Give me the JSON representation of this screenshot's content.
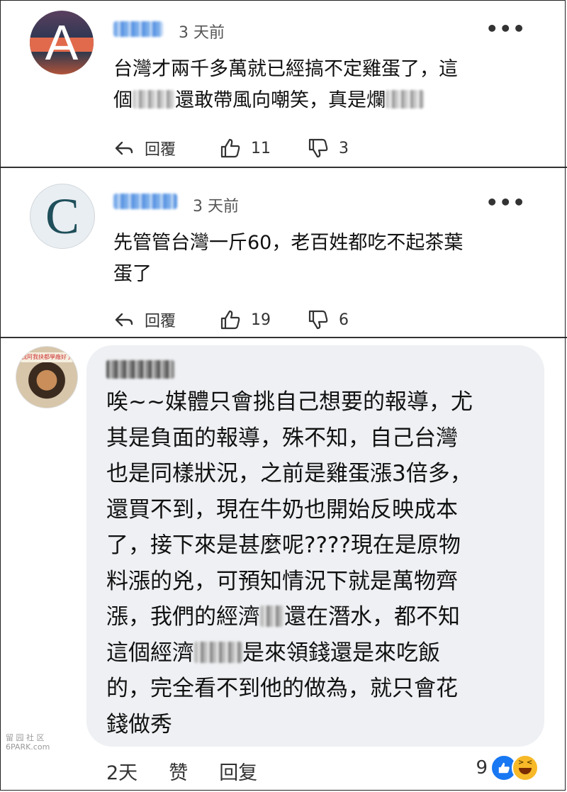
{
  "comments": [
    {
      "avatar_letter": "A",
      "time": "3 天前",
      "text_a": "台灣才兩千多萬就已經搞不定雞蛋了，這",
      "text_b1": "個",
      "text_b2": "還敢帶風向嘲笑，真是爛",
      "reply_label": "回覆",
      "likes": "11",
      "dislikes": "3"
    },
    {
      "avatar_letter": "C",
      "time": "3 天前",
      "text_a": "先管管台灣一斤60，老百姓都吃不起茶葉",
      "text_b": "蛋了",
      "reply_label": "回覆",
      "likes": "19",
      "dislikes": "6"
    }
  ],
  "fb_comment": {
    "avatar_banner": "我阿我抉都學廠好了",
    "lines": {
      "l1": "唉~~媒體只會挑自己想要的報導，尤",
      "l2": "其是負面的報導，殊不知，自己台灣",
      "l3": "也是同樣狀況，之前是雞蛋漲3倍多，",
      "l4": "還買不到，現在牛奶也開始反映成本",
      "l5": "了，接下來是甚麼呢????現在是原物",
      "l6": "料漲的兇，可預知情況下就是萬物齊",
      "l7a": "漲，我們的經濟",
      "l7b": "還在潛水，都不知",
      "l8a": "這個經濟",
      "l8b": "是來領錢還是來吃飯",
      "l9": "的，完全看不到他的做為，就只會花",
      "l10": "錢做秀"
    },
    "time": "2天",
    "like_label": "赞",
    "reply_label": "回复",
    "reaction_count": "9"
  },
  "watermark": {
    "line1": "留 园 社 区",
    "line2": "6PARK.com"
  },
  "icons": [
    "reply-icon",
    "thumbs-up-icon",
    "thumbs-down-icon",
    "more-dots-icon",
    "like-reaction-icon",
    "haha-reaction-icon"
  ]
}
